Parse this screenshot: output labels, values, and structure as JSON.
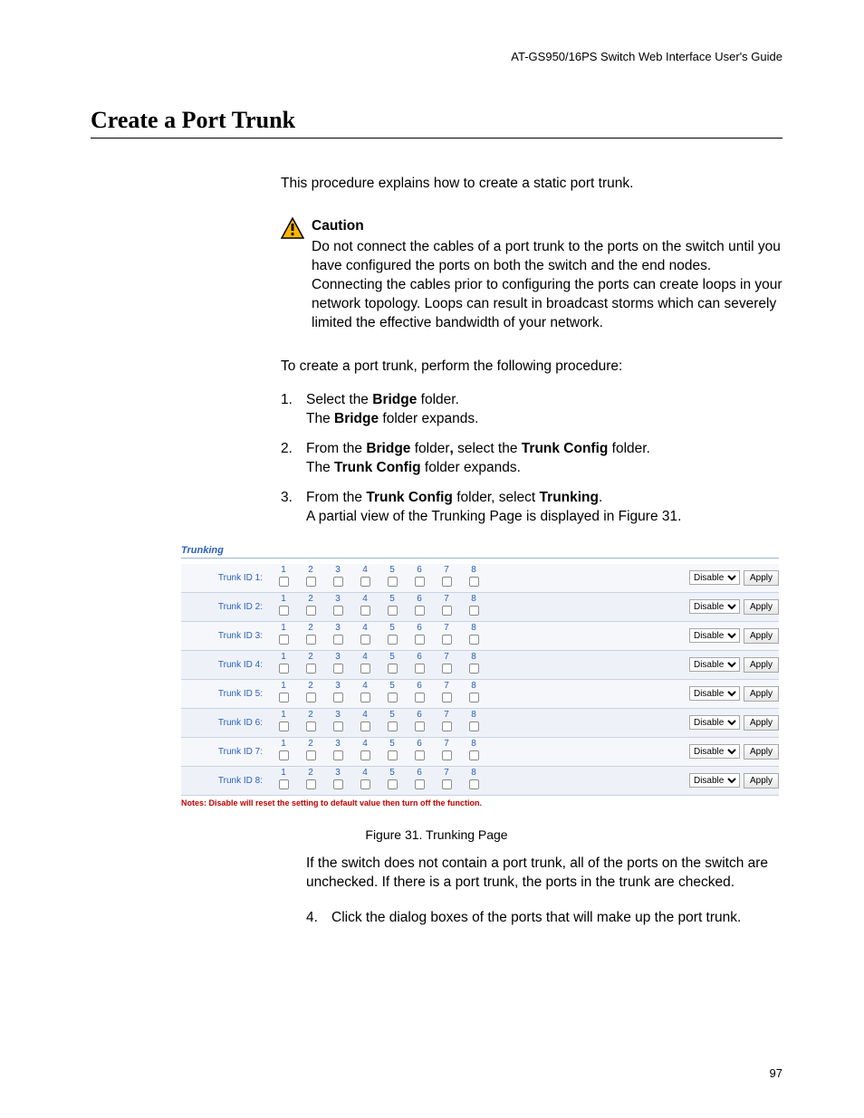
{
  "header": "AT-GS950/16PS Switch Web Interface User's Guide",
  "title": "Create a Port Trunk",
  "intro": "This procedure explains how to create a static port trunk.",
  "caution": {
    "label": "Caution",
    "body": "Do not connect the cables of a port trunk to the ports on the switch until you have configured the ports on both the switch and the end nodes. Connecting the cables prior to configuring the ports can create loops in your network topology. Loops can result in broadcast storms which can severely limited the effective bandwidth of your network."
  },
  "lead": "To create a port trunk, perform the following procedure:",
  "steps": {
    "s1": {
      "num": "1.",
      "a1": "Select the ",
      "b1": "Bridge",
      "a2": " folder.",
      "line2a": "The ",
      "line2b": "Bridge",
      "line2c": " folder expands."
    },
    "s2": {
      "num": "2.",
      "a1": "From the ",
      "b1": "Bridge",
      "a2": " folder",
      "comma": ",",
      "a3": " select the ",
      "b2": "Trunk Config",
      "a4": " folder.",
      "line2a": "The ",
      "line2b": "Trunk Config",
      "line2c": " folder expands."
    },
    "s3": {
      "num": "3.",
      "a1": "From the ",
      "b1": "Trunk Config",
      "a2": " folder, select ",
      "b2": "Trunking",
      "a3": ".",
      "line2": "A partial view of the Trunking Page is displayed in Figure 31."
    },
    "s4": {
      "num": "4.",
      "text": "Click the dialog boxes of the ports that will make up the port trunk."
    }
  },
  "figure": {
    "panelTitle": "Trunking",
    "ports": [
      "1",
      "2",
      "3",
      "4",
      "5",
      "6",
      "7",
      "8"
    ],
    "rows": [
      "Trunk ID 1:",
      "Trunk ID 2:",
      "Trunk ID 3:",
      "Trunk ID 4:",
      "Trunk ID 5:",
      "Trunk ID 6:",
      "Trunk ID 7:",
      "Trunk ID 8:"
    ],
    "selectValue": "Disable",
    "applyLabel": "Apply",
    "notes": "Notes: Disable will reset the setting to default value then turn off the function.",
    "caption": "Figure 31. Trunking Page"
  },
  "afterFigure": "If the switch does not contain a port trunk, all of the ports on the switch are unchecked. If there is a port trunk, the ports in the trunk are checked.",
  "pageNumber": "97"
}
